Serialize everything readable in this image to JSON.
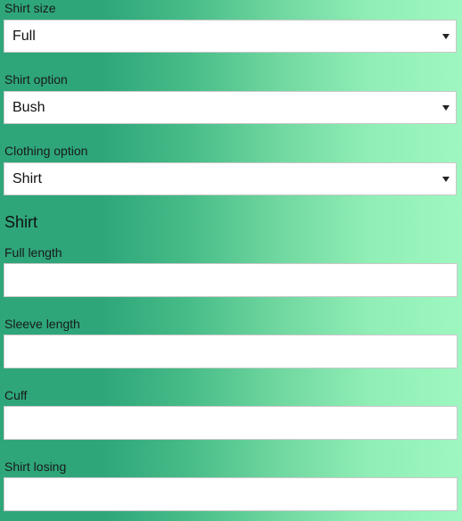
{
  "form": {
    "shirt_size": {
      "label": "Shirt size",
      "value": "Full"
    },
    "shirt_option": {
      "label": "Shirt option",
      "value": "Bush"
    },
    "clothing_option": {
      "label": "Clothing option",
      "value": "Shirt"
    },
    "section_title": "Shirt",
    "full_length": {
      "label": "Full length",
      "value": ""
    },
    "sleeve_length": {
      "label": "Sleeve length",
      "value": ""
    },
    "cuff": {
      "label": "Cuff",
      "value": ""
    },
    "shirt_losing": {
      "label": "Shirt losing",
      "value": ""
    }
  },
  "icons": {
    "dropdown": "caret-down-icon"
  },
  "colors": {
    "gradient_left": "#2ea67a",
    "gradient_right": "#9ef7c0"
  }
}
